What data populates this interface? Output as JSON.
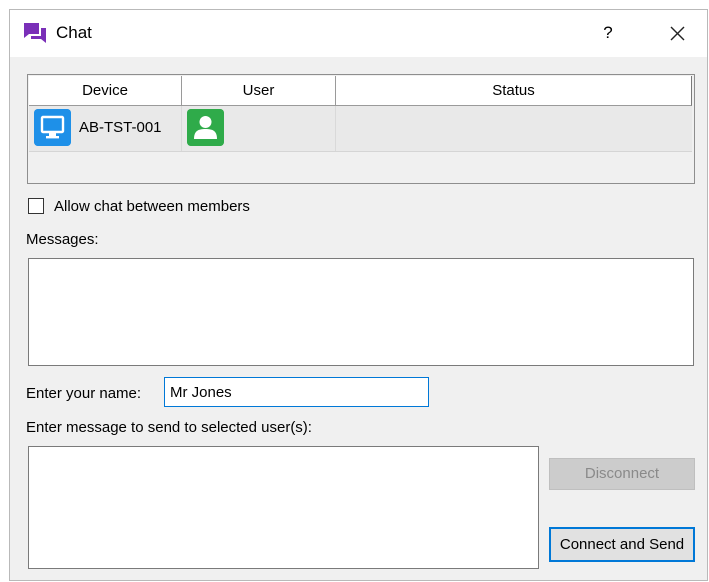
{
  "window": {
    "title": "Chat",
    "help_label": "?",
    "icon": "chat-bubbles-icon",
    "accent": "#7a2fb8"
  },
  "devices_table": {
    "columns": [
      "Device",
      "User",
      "Status"
    ],
    "rows": [
      {
        "device": "AB-TST-001",
        "device_icon": "monitor-icon",
        "user_icon": "user-icon",
        "status": ""
      }
    ]
  },
  "options": {
    "allow_chat_label": "Allow chat between members",
    "allow_chat_checked": false
  },
  "messages": {
    "label": "Messages:",
    "content": ""
  },
  "name": {
    "label": "Enter your name:",
    "value": "Mr Jones"
  },
  "compose": {
    "label": "Enter message to send to selected user(s):",
    "value": ""
  },
  "buttons": {
    "disconnect": "Disconnect",
    "connect_send": "Connect and Send"
  },
  "colors": {
    "device_icon": "#1e90e8",
    "user_icon": "#2fab4a",
    "focus": "#0078d7"
  }
}
